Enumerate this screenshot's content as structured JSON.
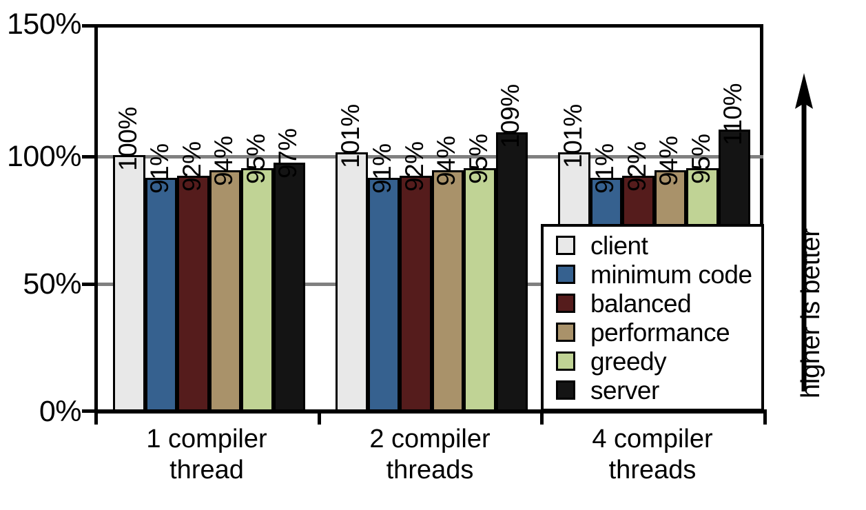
{
  "chart_data": {
    "type": "bar",
    "title": "",
    "subtitle": "",
    "xlabel": "",
    "ylabel": "",
    "categories": [
      "1 compiler\nthread",
      "2 compiler\nthreads",
      "4 compiler\nthreads"
    ],
    "series": [
      {
        "name": "client",
        "color": "#e8e8e8",
        "values": [
          100,
          101,
          101
        ],
        "labels": [
          "100%",
          "101%",
          "101%"
        ]
      },
      {
        "name": "minimum code",
        "color": "#36618f",
        "values": [
          91,
          91,
          91
        ],
        "labels": [
          "91%",
          "91%",
          "91%"
        ]
      },
      {
        "name": "balanced",
        "color": "#551c1c",
        "values": [
          92,
          92,
          92
        ],
        "labels": [
          "92%",
          "92%",
          "92%"
        ]
      },
      {
        "name": "performance",
        "color": "#a9926a",
        "values": [
          94,
          94,
          94
        ],
        "labels": [
          "94%",
          "94%",
          "94%"
        ]
      },
      {
        "name": "greedy",
        "color": "#c0d395",
        "values": [
          95,
          95,
          95
        ],
        "labels": [
          "95%",
          "95%",
          "95%"
        ]
      },
      {
        "name": "server",
        "color": "#141414",
        "values": [
          97,
          109,
          110
        ],
        "labels": [
          "97%",
          "109%",
          "110%"
        ]
      }
    ],
    "ylim": [
      0,
      150
    ],
    "ytick_labels": [
      "150%",
      "100%",
      "50%",
      "0%"
    ],
    "ytick_values": [
      150,
      100,
      50,
      0
    ],
    "gridlines": [
      100,
      50
    ],
    "grid": true,
    "legend_position": "bottom-right",
    "annotation": "higher is better",
    "annotation_icon": "up-arrow-icon",
    "unit": "%"
  },
  "yaxis": {
    "ticks": [
      {
        "label": "150%",
        "value": 150
      },
      {
        "label": "100%",
        "value": 100
      },
      {
        "label": "50%",
        "value": 50
      },
      {
        "label": "0%",
        "value": 0
      }
    ]
  },
  "xaxis": {
    "categories": [
      {
        "line1": "1 compiler",
        "line2": "thread"
      },
      {
        "line1": "2 compiler",
        "line2": "threads"
      },
      {
        "line1": "4 compiler",
        "line2": "threads"
      }
    ]
  },
  "legend": {
    "items": [
      {
        "label": "client",
        "color": "#e8e8e8"
      },
      {
        "label": "minimum code",
        "color": "#36618f"
      },
      {
        "label": "balanced",
        "color": "#551c1c"
      },
      {
        "label": "performance",
        "color": "#a9926a"
      },
      {
        "label": "greedy",
        "color": "#c0d395"
      },
      {
        "label": "server",
        "color": "#141414"
      }
    ]
  },
  "annotation": {
    "text": "higher is better"
  }
}
